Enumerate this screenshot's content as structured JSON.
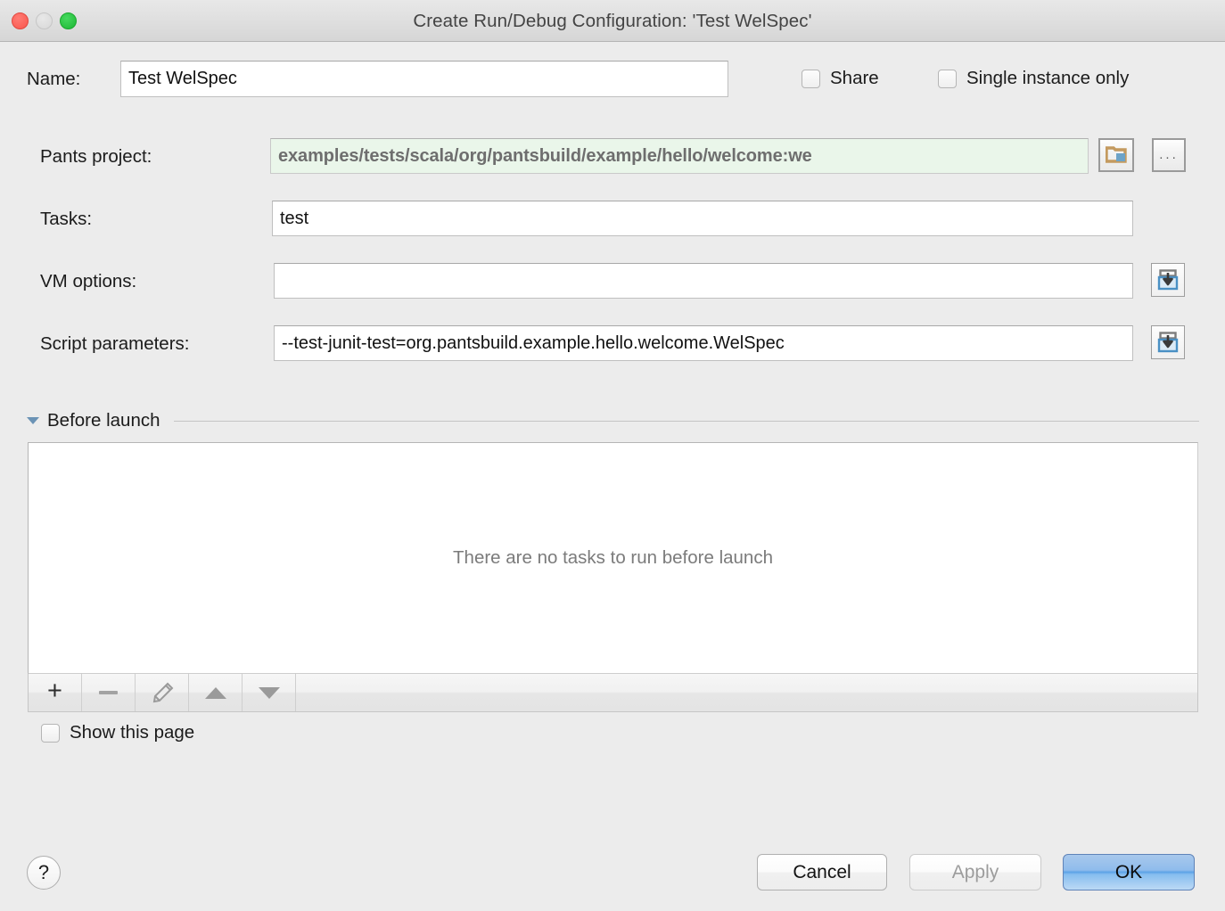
{
  "window": {
    "title": "Create Run/Debug Configuration: 'Test WelSpec'",
    "controls": {
      "close": "close-button",
      "minimize": "minimize-button",
      "zoom": "zoom-button"
    }
  },
  "form": {
    "name": {
      "label": "Name:",
      "value": "Test WelSpec",
      "placeholder": ""
    },
    "share": {
      "label": "Share",
      "checked": false
    },
    "single_instance": {
      "label": "Single instance only",
      "checked": false
    },
    "pants_project": {
      "label": "Pants project:",
      "value": "examples/tests/scala/org/pantsbuild/example/hello/welcome:we",
      "placeholder": "",
      "background_color": "#eaf6ea",
      "text_color": "#6e6e6e",
      "browse_folder_icon": "folder-icon",
      "browse_more_label": "..."
    },
    "tasks": {
      "label": "Tasks:",
      "value": "test",
      "placeholder": ""
    },
    "vm_options": {
      "label": "VM options:",
      "value": "",
      "placeholder": "",
      "expand_icon": "expand-icon"
    },
    "script_parameters": {
      "label": "Script parameters:",
      "value": "--test-junit-test=org.pantsbuild.example.hello.welcome.WelSpec",
      "placeholder": "",
      "expand_icon": "expand-icon"
    }
  },
  "before_launch": {
    "title": "Before launch",
    "expanded": true,
    "empty_message": "There are no tasks to run before launch",
    "toolbar": [
      {
        "name": "add-task-button",
        "glyph": "plus-icon",
        "enabled": true
      },
      {
        "name": "remove-task-button",
        "glyph": "minus-icon",
        "enabled": false
      },
      {
        "name": "edit-task-button",
        "glyph": "pencil-icon",
        "enabled": false
      },
      {
        "name": "move-up-button",
        "glyph": "triangle-up-icon",
        "enabled": false
      },
      {
        "name": "move-down-button",
        "glyph": "triangle-down-icon",
        "enabled": false
      }
    ],
    "show_this_page": {
      "label": "Show this page",
      "checked": false
    }
  },
  "footer": {
    "help_label": "?",
    "cancel_label": "Cancel",
    "apply_label": "Apply",
    "apply_enabled": false,
    "ok_label": "OK",
    "ok_is_default": true,
    "accent_color": "#5ba2e6"
  }
}
